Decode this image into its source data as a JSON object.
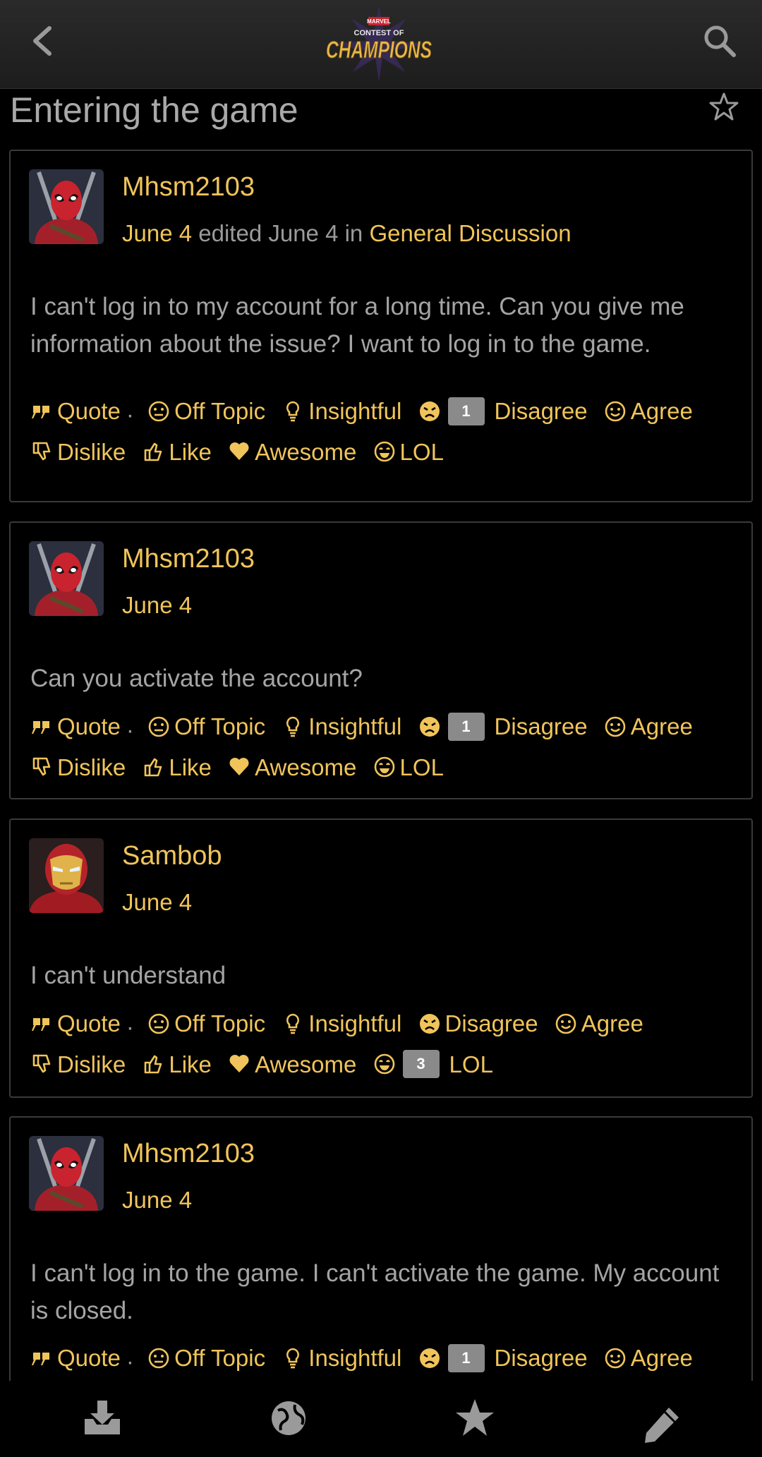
{
  "header": {
    "back_icon": "chevron-left-icon",
    "logo": {
      "top": "MARVEL",
      "middle": "CONTEST OF",
      "bottom": "CHAMPIONS"
    },
    "search_icon": "search-icon"
  },
  "thread": {
    "title": "Entering the game",
    "bookmark_icon": "star-outline-icon"
  },
  "posts": [
    {
      "author": "Mhsm2103",
      "avatar": "deadpool-avatar",
      "date": "June 4",
      "edited_label": "edited June 4 in",
      "category": "General Discussion",
      "body": "I can't log in to my account for a long time. Can you give me information about the issue? I want to log in to the game.",
      "reactions": {
        "quote": "Quote",
        "off_topic": "Off Topic",
        "insightful": "Insightful",
        "disagree_count": "1",
        "disagree": "Disagree",
        "agree": "Agree",
        "dislike": "Dislike",
        "like": "Like",
        "awesome": "Awesome",
        "lol": "LOL"
      }
    },
    {
      "author": "Mhsm2103",
      "avatar": "deadpool-avatar",
      "date": "June 4",
      "body": "Can you activate the account?",
      "reactions": {
        "quote": "Quote",
        "off_topic": "Off Topic",
        "insightful": "Insightful",
        "disagree_count": "1",
        "disagree": "Disagree",
        "agree": "Agree",
        "dislike": "Dislike",
        "like": "Like",
        "awesome": "Awesome",
        "lol": "LOL"
      }
    },
    {
      "author": "Sambob",
      "avatar": "iron-man-avatar",
      "date": "June 4",
      "body": "I can't understand",
      "reactions": {
        "quote": "Quote",
        "off_topic": "Off Topic",
        "insightful": "Insightful",
        "disagree": "Disagree",
        "agree": "Agree",
        "dislike": "Dislike",
        "like": "Like",
        "awesome": "Awesome",
        "lol_count": "3",
        "lol": "LOL"
      }
    },
    {
      "author": "Mhsm2103",
      "avatar": "deadpool-avatar",
      "date": "June 4",
      "body": "I can't log in to the game. I can't activate the game. My account is closed.",
      "reactions": {
        "quote": "Quote",
        "off_topic": "Off Topic",
        "insightful": "Insightful",
        "disagree_count": "1",
        "disagree": "Disagree",
        "agree": "Agree"
      }
    }
  ],
  "bottom_nav": [
    {
      "icon": "inbox-download-icon"
    },
    {
      "icon": "globe-icon"
    },
    {
      "icon": "star-icon"
    },
    {
      "icon": "pencil-icon"
    }
  ],
  "colors": {
    "accent": "#f0c45a",
    "background": "#000000",
    "text": "#9a9a9a",
    "badge": "#8a8a8a"
  }
}
